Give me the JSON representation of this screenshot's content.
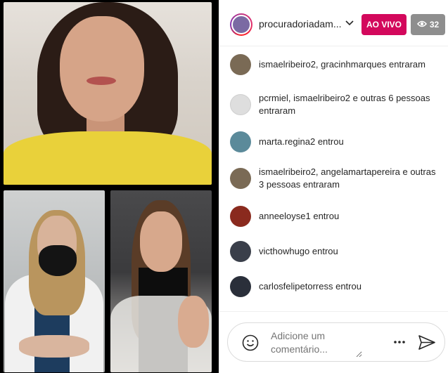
{
  "header": {
    "host_name": "procuradoriadam...",
    "live_label": "AO VIVO",
    "viewer_count": "32",
    "live_color": "#d3085c"
  },
  "comments": [
    {
      "text": "ismaelribeiro2, gracinhmarques entraram",
      "avatar_color": "#7a6a55"
    },
    {
      "text": "pcrmiel, ismaelribeiro2 e outras 6 pessoas entraram",
      "avatar_color": "#dedede"
    },
    {
      "text": "marta.regina2 entrou",
      "avatar_color": "#5b8a9a"
    },
    {
      "text": "ismaelribeiro2, angelamartapereira e outras 3 pessoas entraram",
      "avatar_color": "#7a6a55"
    },
    {
      "text": "anneeloyse1 entrou",
      "avatar_color": "#8a2a1e"
    },
    {
      "text": "victhowhugo entrou",
      "avatar_color": "#3a3f4a"
    },
    {
      "text": "carlosfelipetorress entrou",
      "avatar_color": "#2a2f3a"
    }
  ],
  "composer": {
    "placeholder": "Adicione um comentário..."
  },
  "icons": {
    "viewer": "eye-icon",
    "emoji": "smiley-icon",
    "more": "more-dots-icon",
    "send": "send-icon",
    "chevron": "chevron-down-icon"
  }
}
